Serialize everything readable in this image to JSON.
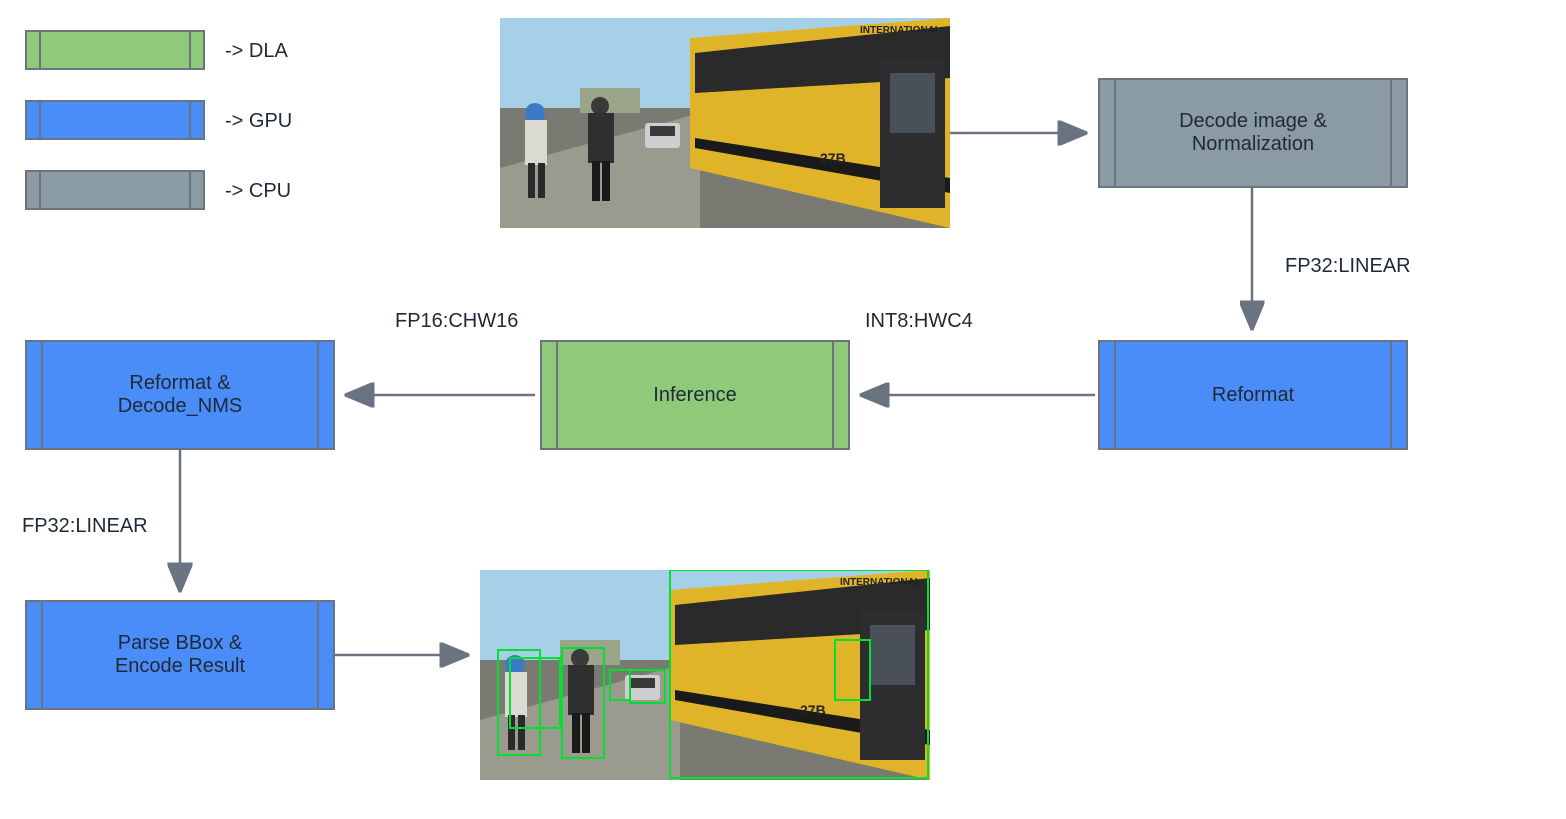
{
  "legend": {
    "dla": "-> DLA",
    "gpu": "-> GPU",
    "cpu": "-> CPU"
  },
  "nodes": {
    "decode": "Decode image &\nNormalization",
    "reformat1": "Reformat",
    "inference": "Inference",
    "reformat_nms": "Reformat &\nDecode_NMS",
    "parse": "Parse BBox &\nEncode Result"
  },
  "edges": {
    "fp32_linear_top": "FP32:LINEAR",
    "int8_hwc4": "INT8:HWC4",
    "fp16_chw16": "FP16:CHW16",
    "fp32_linear_bottom": "FP32:LINEAR"
  },
  "colors": {
    "dla": "#8fc97a",
    "gpu": "#4b8df8",
    "cpu": "#8b9ba3",
    "border": "#6b7280"
  },
  "image_content": {
    "description": "street scene with yellow school bus labeled 27B INTERNATIONAL and pedestrians",
    "bus_number": "27B",
    "bus_brand": "INTERNATIONAL"
  }
}
